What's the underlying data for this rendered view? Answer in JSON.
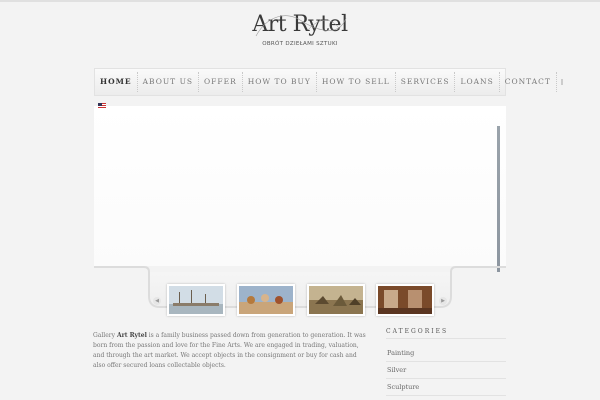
{
  "logo": {
    "title": "Art Rytel",
    "subtitle": "OBRÓT DZIEŁAMI SZTUKI"
  },
  "nav": {
    "items": [
      {
        "label": "HOME",
        "active": true
      },
      {
        "label": "ABOUT US",
        "active": false
      },
      {
        "label": "OFFER",
        "active": false
      },
      {
        "label": "HOW TO BUY",
        "active": false
      },
      {
        "label": "HOW TO SELL",
        "active": false
      },
      {
        "label": "SERVICES",
        "active": false
      },
      {
        "label": "LOANS",
        "active": false
      },
      {
        "label": "CONTACT",
        "active": false
      }
    ],
    "language_icon": "polish-flag-icon"
  },
  "slider": {
    "language_icon": "us-flag-icon",
    "thumbnails": [
      {
        "name": "harbor-painting-icon",
        "colors": [
          "#c9d6e0",
          "#8a7c6a"
        ]
      },
      {
        "name": "figures-painting-icon",
        "colors": [
          "#8fa7c2",
          "#b5793c"
        ]
      },
      {
        "name": "battle-painting-icon",
        "colors": [
          "#b39d73",
          "#6b5a3a"
        ]
      },
      {
        "name": "interior-painting-icon",
        "colors": [
          "#7a4a2a",
          "#c8a98a"
        ]
      }
    ]
  },
  "intro": {
    "prefix": "Gallery ",
    "brand": "Art Rytel",
    "text": " is a family business passed down from generation to generation. It was born from the passion and love for the Fine Arts. We are engaged in trading, valuation, and through the art market. We accept objects in the consignment or buy for cash and also offer secured loans collectable objects."
  },
  "categories": {
    "title": "CATEGORIES",
    "items": [
      "Painting",
      "Silver",
      "Sculpture"
    ]
  }
}
